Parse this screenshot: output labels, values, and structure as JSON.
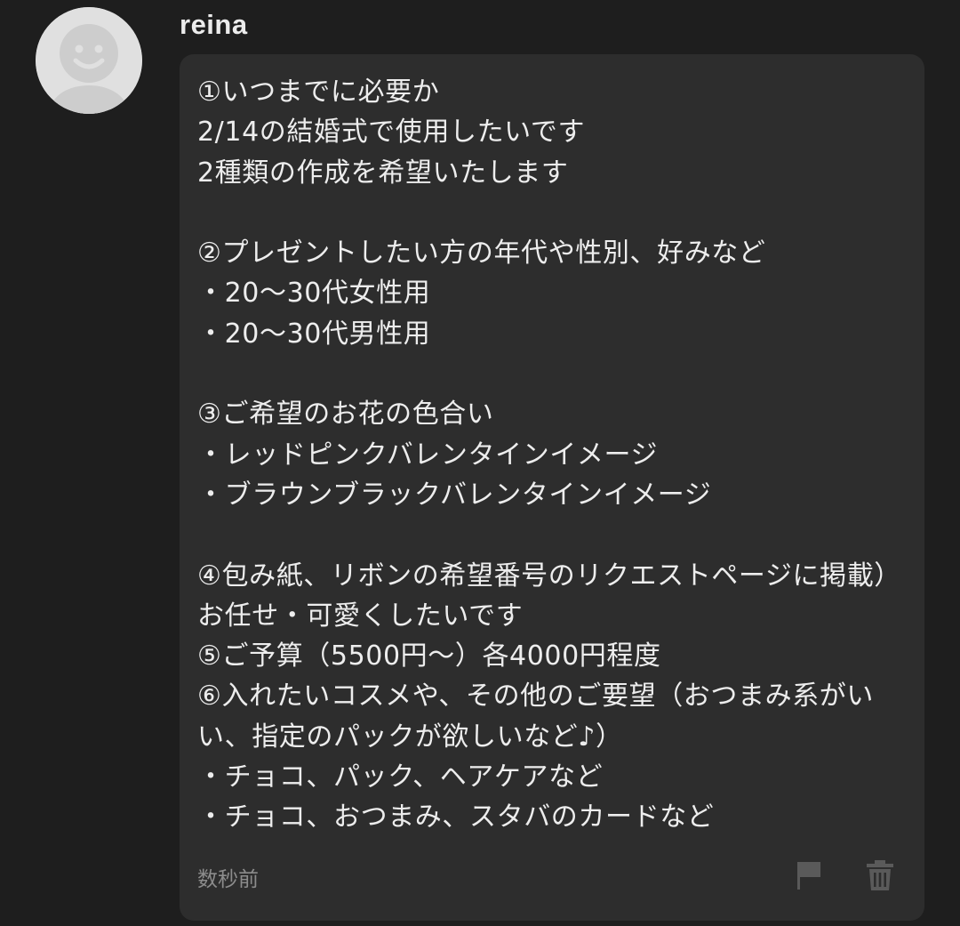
{
  "comment": {
    "username": "reina",
    "message": "①いつまでに必要か\n2/14の結婚式で使用したいです\n2種類の作成を希望いたします\n\n②プレゼントしたい方の年代や性別、好みなど\n・20〜30代女性用\n・20〜30代男性用\n\n③ご希望のお花の色合い\n・レッドピンクバレンタインイメージ\n・ブラウンブラックバレンタインイメージ\n\n④包み紙、リボンの希望番号のリクエストページに掲載）お任せ・可愛くしたいです\n⑤ご予算（5500円〜）各4000円程度\n⑥入れたいコスメや、その他のご要望（おつまみ系がいい、指定のパックが欲しいなど♪）\n・チョコ、パック、ヘアケアなど\n・チョコ、おつまみ、スタバのカードなど",
    "timestamp": "数秒前",
    "icons": {
      "avatar": "default-avatar-icon",
      "flag": "flag-icon",
      "trash": "trash-icon"
    }
  },
  "colors": {
    "background": "#1e1e1e",
    "bubble": "#2d2d2d",
    "text": "#ededed",
    "muted": "#8c8c8c",
    "icon": "#5a5a5a"
  }
}
